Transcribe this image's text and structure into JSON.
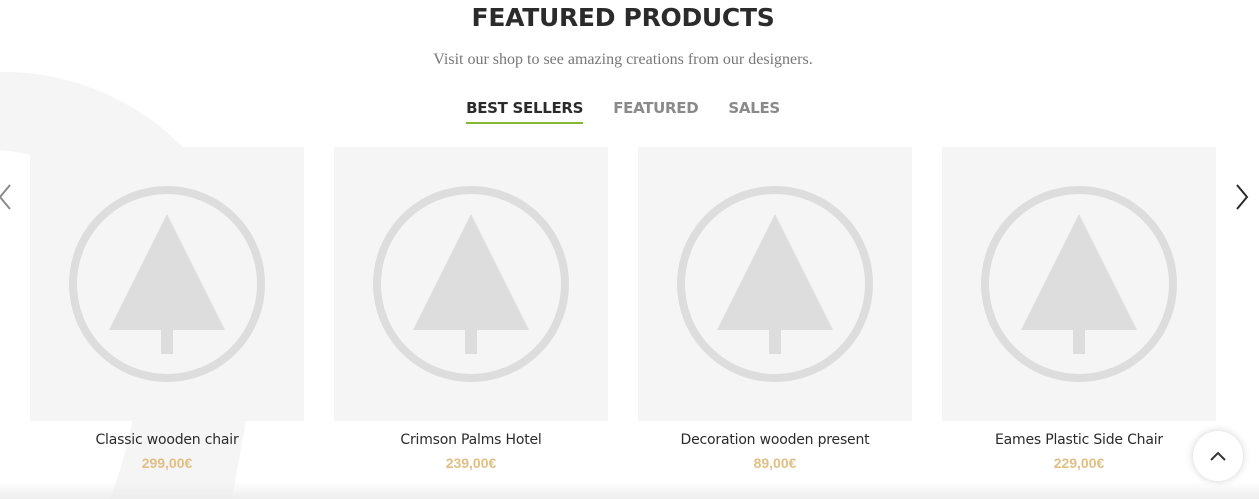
{
  "section": {
    "title": "FEATURED PRODUCTS",
    "subtitle": "Visit our shop to see amazing creations from our designers."
  },
  "tabs": [
    {
      "label": "BEST SELLERS",
      "active": true
    },
    {
      "label": "FEATURED",
      "active": false
    },
    {
      "label": "SALES",
      "active": false
    }
  ],
  "products": [
    {
      "name": "Classic wooden chair",
      "price": "299,00€",
      "image_icon": "placeholder-tree-icon"
    },
    {
      "name": "Crimson Palms Hotel",
      "price": "239,00€",
      "image_icon": "placeholder-tree-icon"
    },
    {
      "name": "Decoration wooden present",
      "price": "89,00€",
      "image_icon": "placeholder-tree-icon"
    },
    {
      "name": "Eames Plastic Side Chair",
      "price": "229,00€",
      "image_icon": "placeholder-tree-icon"
    }
  ],
  "controls": {
    "prev_icon": "chevron-left-icon",
    "next_icon": "chevron-right-icon",
    "scroll_top_icon": "chevron-up-icon"
  },
  "colors": {
    "accent": "#83b735",
    "price": "#e0bf85",
    "placeholder_bg": "#f5f5f5",
    "placeholder_icon": "#dddddd"
  }
}
